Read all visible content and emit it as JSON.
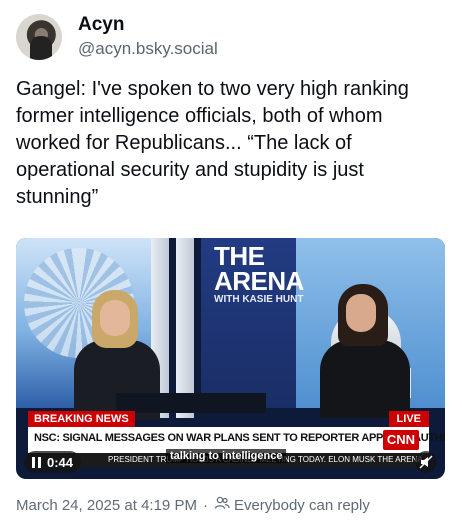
{
  "author": {
    "display_name": "Acyn",
    "handle": "@acyn.bsky.social",
    "avatar_icon": "avatar-photo"
  },
  "post": {
    "text": "Gangel: I've spoken to two very high ranking former intelligence officials, both of whom worked for Republicans... “The lack of operational security and stupidity is just stunning”"
  },
  "video": {
    "show_logo_line1": "THE",
    "show_logo_line2": "ARENA",
    "show_logo_line3": "WITH KASIE HUNT",
    "breaking_label": "BREAKING NEWS",
    "live_label": "LIVE",
    "headline": "NSC: SIGNAL MESSAGES ON WAR PLANS SENT TO REPORTER APPEAR \"AUTHENTIC\"",
    "network_logo": "CNN",
    "ticker": "PRESIDENT TRUMP HOLDS A CABINET MEETING TODAY. ELON MUSK THE ARENA",
    "caption": "talking to intelligence",
    "time": "0:44",
    "play_state_icon": "pause-icon",
    "sound_icon": "mute-icon"
  },
  "meta": {
    "timestamp": "March 24, 2025 at 4:19 PM",
    "separator": "·",
    "reply_setting": "Everybody can reply",
    "reply_icon": "people-icon"
  },
  "colors": {
    "accent_red": "#cc0000",
    "text_primary": "#0b0f14",
    "text_secondary": "#5f6b77"
  }
}
